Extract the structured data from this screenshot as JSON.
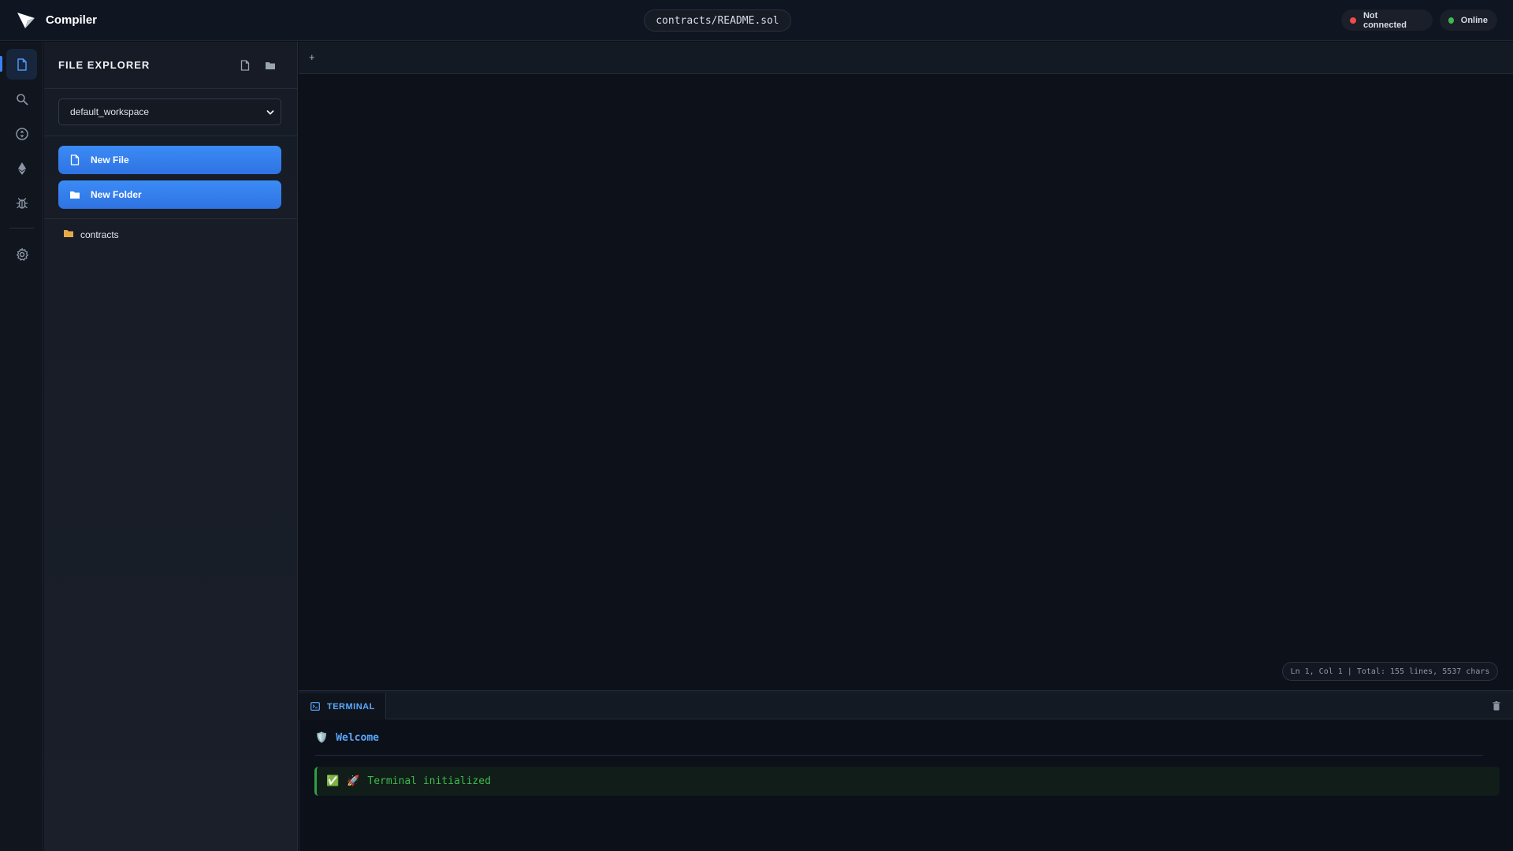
{
  "header": {
    "app_title": "Compiler",
    "file_path": "contracts/README.sol",
    "status_connection": "Not connected",
    "status_network": "Online",
    "colors": {
      "disconnected": "#f04a4a",
      "online": "#3fb950"
    }
  },
  "activity_bar": {
    "items": [
      {
        "name": "file-explorer",
        "icon": "file-icon",
        "active": true
      },
      {
        "name": "search",
        "icon": "search-icon",
        "active": false
      },
      {
        "name": "compiler",
        "icon": "compile-icon",
        "active": false
      },
      {
        "name": "deploy",
        "icon": "ethereum-icon",
        "active": false
      },
      {
        "name": "debugger",
        "icon": "bug-icon",
        "active": false
      },
      {
        "name": "settings",
        "icon": "gear-icon",
        "active": false
      }
    ]
  },
  "sidebar": {
    "title": "FILE EXPLORER",
    "workspace": "default_workspace",
    "new_file_label": "New File",
    "new_folder_label": "New Folder",
    "tree": [
      {
        "type": "folder",
        "label": "contracts"
      }
    ]
  },
  "editor": {
    "add_tab": "+",
    "cursor_info": "Ln 1, Col 1 | Total: 155 lines, 5537 chars"
  },
  "terminal": {
    "tab_label": "TERMINAL",
    "welcome_icon": "🛡️",
    "welcome_text": "Welcome",
    "lines": [
      {
        "status_icon": "✅",
        "icon": "🚀",
        "text": "Terminal initialized"
      }
    ]
  },
  "theme": {
    "accent": "#3b82f6",
    "background": "#0d1117"
  }
}
